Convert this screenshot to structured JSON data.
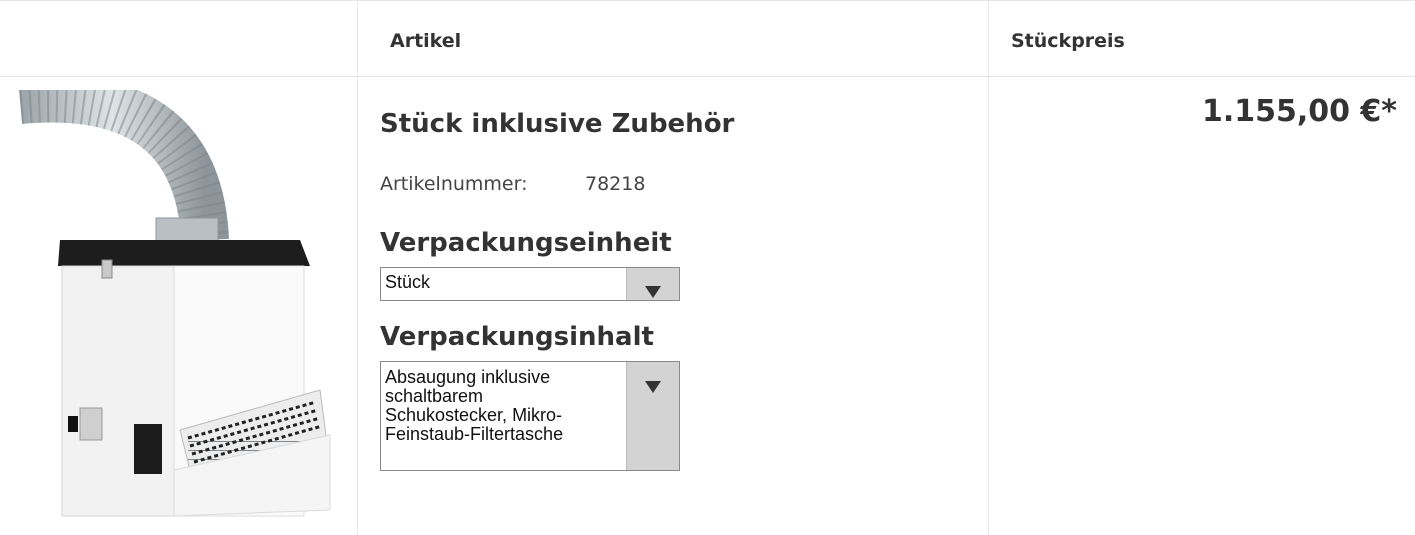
{
  "columns": {
    "article": "Artikel",
    "unit_price": "Stückpreis"
  },
  "product": {
    "image_alt": "Absauggerät mit Schlauch",
    "title": "Stück inklusive Zubehör",
    "article_number_label": "Artikelnummer:",
    "article_number": "78218",
    "packaging_unit_label": "Verpackungseinheit",
    "packaging_unit_value": "Stück",
    "packaging_content_label": "Verpackungsinhalt",
    "packaging_content_lines": [
      "Absaugung inklusive",
      "schaltbarem",
      "Schukostecker, Mikro-",
      "Feinstaub-Filtertasche"
    ],
    "price": "1.155,00 €*"
  },
  "icons": {
    "select_arrow": "triangle-down-icon"
  }
}
